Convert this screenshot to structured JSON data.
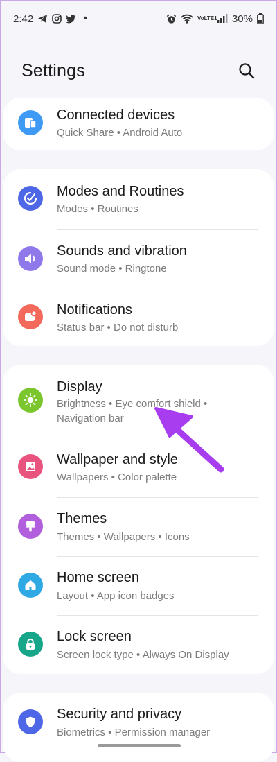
{
  "status_bar": {
    "time": "2:42",
    "dot": "•",
    "lte_label": "VoLTE1",
    "battery": "30%"
  },
  "header": {
    "title": "Settings"
  },
  "items": [
    {
      "title": "Connected devices",
      "subtitle": "Quick Share  •  Android Auto",
      "icon": "connected-devices-icon",
      "color": "#3f9af6"
    },
    {
      "title": "Modes and Routines",
      "subtitle": "Modes  •  Routines",
      "icon": "modes-routines-icon",
      "color": "#4e67e6"
    },
    {
      "title": "Sounds and vibration",
      "subtitle": "Sound mode  •  Ringtone",
      "icon": "volume-icon",
      "color": "#8f79ea"
    },
    {
      "title": "Notifications",
      "subtitle": "Status bar  •  Do not disturb",
      "icon": "notifications-icon",
      "color": "#f36a5c"
    },
    {
      "title": "Display",
      "subtitle": "Brightness  •  Eye comfort shield  •  Navigation bar",
      "icon": "display-sun-icon",
      "color": "#7bc62d"
    },
    {
      "title": "Wallpaper and style",
      "subtitle": "Wallpapers  •  Color palette",
      "icon": "wallpaper-icon",
      "color": "#e9547e"
    },
    {
      "title": "Themes",
      "subtitle": "Themes  •  Wallpapers  •  Icons",
      "icon": "themes-brush-icon",
      "color": "#b15fdc"
    },
    {
      "title": "Home screen",
      "subtitle": "Layout  •  App icon badges",
      "icon": "home-icon",
      "color": "#2fa9e4"
    },
    {
      "title": "Lock screen",
      "subtitle": "Screen lock type  •  Always On Display",
      "icon": "lock-icon",
      "color": "#18a68a"
    },
    {
      "title": "Security and privacy",
      "subtitle": "Biometrics  •  Permission manager",
      "icon": "shield-icon",
      "color": "#4e67e6"
    }
  ],
  "colors": {
    "background": "#f6f5fa",
    "card": "#ffffff",
    "annotation_arrow": "#a83df0"
  }
}
